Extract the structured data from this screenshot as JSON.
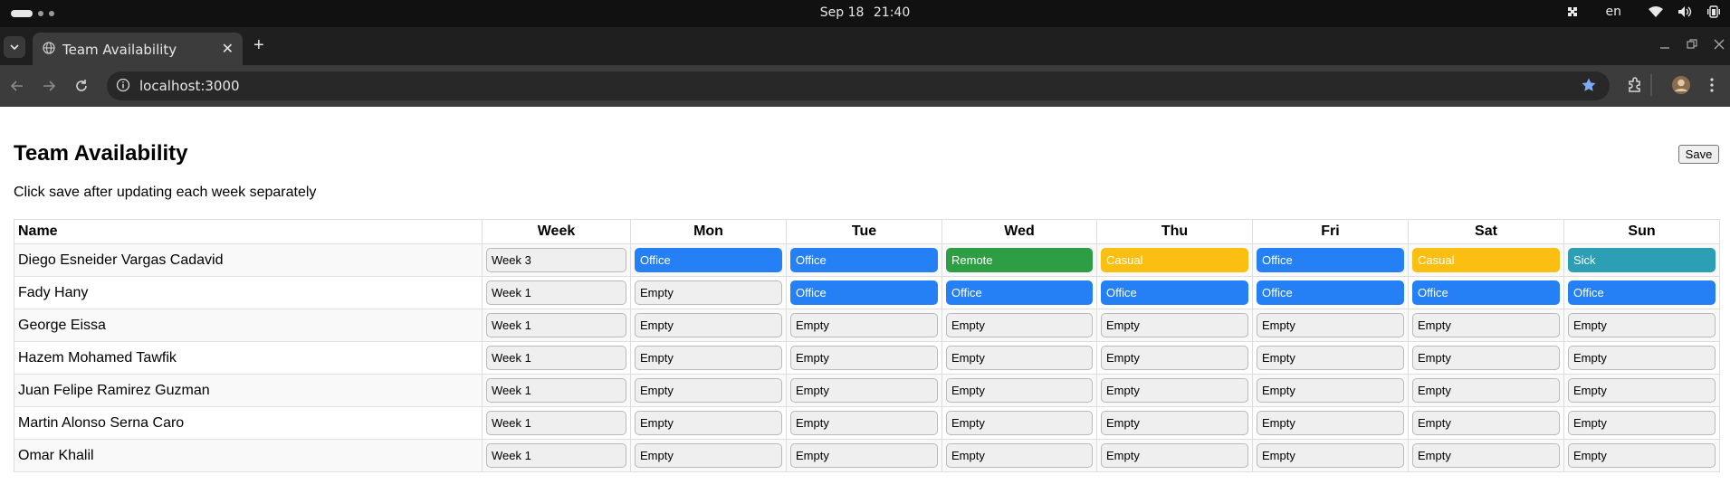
{
  "os": {
    "date": "Sep 18",
    "time": "21:40",
    "language": "en"
  },
  "browser": {
    "tab_title": "Team Availability",
    "url": "localhost:3000"
  },
  "page": {
    "title": "Team Availability",
    "save_label": "Save",
    "subtitle": "Click save after updating each week separately",
    "columns": [
      "Name",
      "Week",
      "Mon",
      "Tue",
      "Wed",
      "Thu",
      "Fri",
      "Sat",
      "Sun"
    ],
    "rows": [
      {
        "name": "Diego Esneider Vargas Cadavid",
        "week": "Week 3",
        "days": [
          "Office",
          "Office",
          "Remote",
          "Casual",
          "Office",
          "Casual",
          "Sick"
        ]
      },
      {
        "name": "Fady Hany",
        "week": "Week 1",
        "days": [
          "Empty",
          "Office",
          "Office",
          "Office",
          "Office",
          "Office",
          "Office"
        ]
      },
      {
        "name": "George Eissa",
        "week": "Week 1",
        "days": [
          "Empty",
          "Empty",
          "Empty",
          "Empty",
          "Empty",
          "Empty",
          "Empty"
        ]
      },
      {
        "name": "Hazem Mohamed Tawfik",
        "week": "Week 1",
        "days": [
          "Empty",
          "Empty",
          "Empty",
          "Empty",
          "Empty",
          "Empty",
          "Empty"
        ]
      },
      {
        "name": "Juan Felipe Ramirez Guzman",
        "week": "Week 1",
        "days": [
          "Empty",
          "Empty",
          "Empty",
          "Empty",
          "Empty",
          "Empty",
          "Empty"
        ]
      },
      {
        "name": "Martin Alonso Serna Caro",
        "week": "Week 1",
        "days": [
          "Empty",
          "Empty",
          "Empty",
          "Empty",
          "Empty",
          "Empty",
          "Empty"
        ]
      },
      {
        "name": "Omar Khalil",
        "week": "Week 1",
        "days": [
          "Empty",
          "Empty",
          "Empty",
          "Empty",
          "Empty",
          "Empty",
          "Empty"
        ]
      }
    ]
  },
  "status_colors": {
    "Office": "#2680f5",
    "Remote": "#2e9e44",
    "Casual": "#fbbf12",
    "Sick": "#2d9fb5",
    "Empty": "#efefef"
  }
}
